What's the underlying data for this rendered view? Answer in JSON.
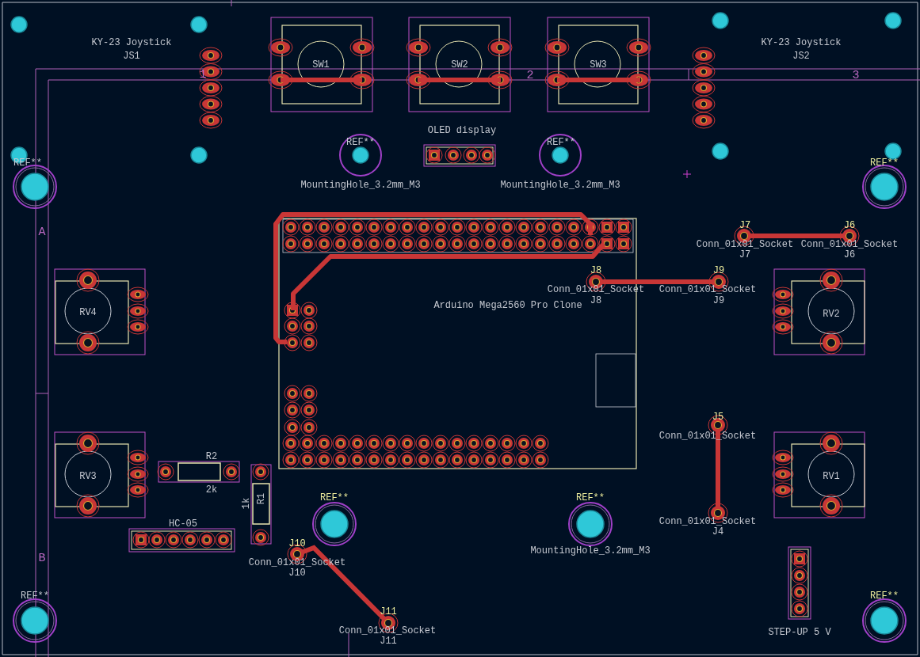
{
  "labels": [
    {
      "text": "KY-23 Joystick",
      "kind": "value"
    },
    {
      "text": "JS1",
      "kind": "value"
    },
    {
      "text": "SW1",
      "kind": "value"
    },
    {
      "text": "SW2",
      "kind": "value"
    },
    {
      "text": "SW3",
      "kind": "value"
    },
    {
      "text": "KY-23 Joystick",
      "kind": "value"
    },
    {
      "text": "JS2",
      "kind": "value"
    },
    {
      "text": "1",
      "kind": "sheet"
    },
    {
      "text": "2",
      "kind": "sheet"
    },
    {
      "text": "3",
      "kind": "sheet"
    },
    {
      "text": "OLED display",
      "kind": "value"
    },
    {
      "text": "REF**",
      "kind": "value"
    },
    {
      "text": "REF**",
      "kind": "value"
    },
    {
      "text": "REF**",
      "kind": "value"
    },
    {
      "text": "REF**",
      "kind": "reference"
    },
    {
      "text": "MountingHole_3.2mm_M3",
      "kind": "value"
    },
    {
      "text": "MountingHole_3.2mm_M3",
      "kind": "value"
    },
    {
      "text": "A",
      "kind": "sheet"
    },
    {
      "text": "J7",
      "kind": "reference"
    },
    {
      "text": "J6",
      "kind": "reference"
    },
    {
      "text": "Conn_01x01_Socket",
      "kind": "value"
    },
    {
      "text": "Conn_01x01_Socket",
      "kind": "value"
    },
    {
      "text": "J7",
      "kind": "value"
    },
    {
      "text": "J6",
      "kind": "value"
    },
    {
      "text": "J8",
      "kind": "reference"
    },
    {
      "text": "J9",
      "kind": "reference"
    },
    {
      "text": "Conn_01x01_Socket",
      "kind": "value"
    },
    {
      "text": "Conn_01x01_Socket",
      "kind": "value"
    },
    {
      "text": "J8",
      "kind": "value"
    },
    {
      "text": "J9",
      "kind": "value"
    },
    {
      "text": "Arduino Mega2560 Pro Clone",
      "kind": "value"
    },
    {
      "text": "RV4",
      "kind": "value"
    },
    {
      "text": "RV2",
      "kind": "value"
    },
    {
      "text": "J5",
      "kind": "reference"
    },
    {
      "text": "Conn_01x01_Socket",
      "kind": "value"
    },
    {
      "text": "R2",
      "kind": "value"
    },
    {
      "text": "RV3",
      "kind": "value"
    },
    {
      "text": "RV1",
      "kind": "value"
    },
    {
      "text": "2k",
      "kind": "value"
    },
    {
      "text": "1k",
      "kind": "value"
    },
    {
      "text": "R1",
      "kind": "value"
    },
    {
      "text": "REF**",
      "kind": "reference"
    },
    {
      "text": "REF**",
      "kind": "reference"
    },
    {
      "text": "Conn_01x01_Socket",
      "kind": "value"
    },
    {
      "text": "J4",
      "kind": "value"
    },
    {
      "text": "HC-05",
      "kind": "value"
    },
    {
      "text": "MountingHole_3.2mm_M3",
      "kind": "value"
    },
    {
      "text": "J10",
      "kind": "reference"
    },
    {
      "text": "B",
      "kind": "sheet"
    },
    {
      "text": "Conn_01x01_Socket",
      "kind": "value"
    },
    {
      "text": "J10",
      "kind": "value"
    },
    {
      "text": "REF**",
      "kind": "value"
    },
    {
      "text": "REF**",
      "kind": "reference"
    },
    {
      "text": "J11",
      "kind": "reference"
    },
    {
      "text": "Conn_01x01_Socket",
      "kind": "value"
    },
    {
      "text": "J11",
      "kind": "value"
    },
    {
      "text": "STEP-UP 5 V",
      "kind": "value"
    }
  ]
}
